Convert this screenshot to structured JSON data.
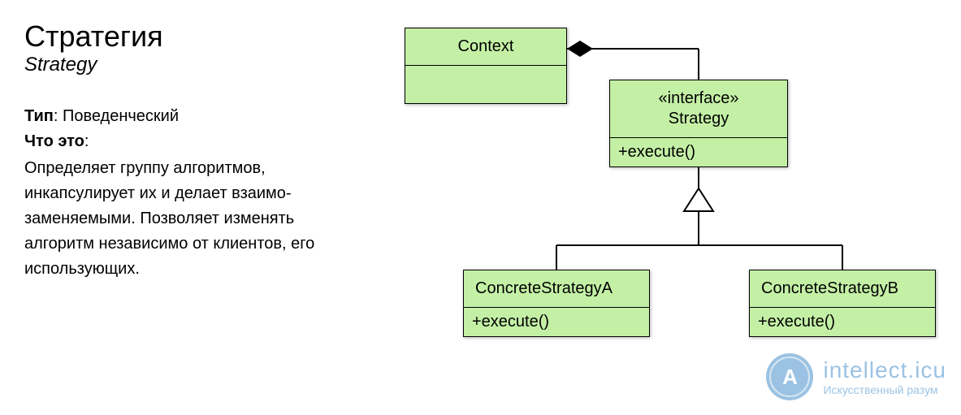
{
  "title": "Стратегия",
  "subtitle": "Strategy",
  "meta": {
    "type_label": "Тип",
    "type_value": ": Поведенческий",
    "what_label": "Что это",
    "what_colon": ":"
  },
  "description": "Определяет группу алгоритмов, инкапсулирует их и делает взаимо-заменяемыми. Позволяет изменять алгоритм независимо от клиентов, его использующих.",
  "nodes": {
    "context": {
      "name": "Context",
      "methods": ""
    },
    "strategy": {
      "stereotype": "«interface»",
      "name": "Strategy",
      "methods": "+execute()"
    },
    "concreteA": {
      "name": "ConcreteStrategyA",
      "methods": "+execute()"
    },
    "concreteB": {
      "name": "ConcreteStrategyB",
      "methods": "+execute()"
    }
  },
  "watermark": {
    "badge": "А",
    "brand": "intellect.icu",
    "tag": "Искусственный разум"
  },
  "chart_data": {
    "type": "table",
    "diagram_kind": "uml-class",
    "pattern": "Strategy",
    "classes": [
      {
        "id": "context",
        "name": "Context",
        "stereotype": null,
        "methods": []
      },
      {
        "id": "strategy",
        "name": "Strategy",
        "stereotype": "interface",
        "methods": [
          "+execute()"
        ]
      },
      {
        "id": "concreteA",
        "name": "ConcreteStrategyA",
        "stereotype": null,
        "methods": [
          "+execute()"
        ]
      },
      {
        "id": "concreteB",
        "name": "ConcreteStrategyB",
        "stereotype": null,
        "methods": [
          "+execute()"
        ]
      }
    ],
    "relations": [
      {
        "from": "context",
        "to": "strategy",
        "kind": "composition"
      },
      {
        "from": "concreteA",
        "to": "strategy",
        "kind": "realization"
      },
      {
        "from": "concreteB",
        "to": "strategy",
        "kind": "realization"
      }
    ]
  }
}
